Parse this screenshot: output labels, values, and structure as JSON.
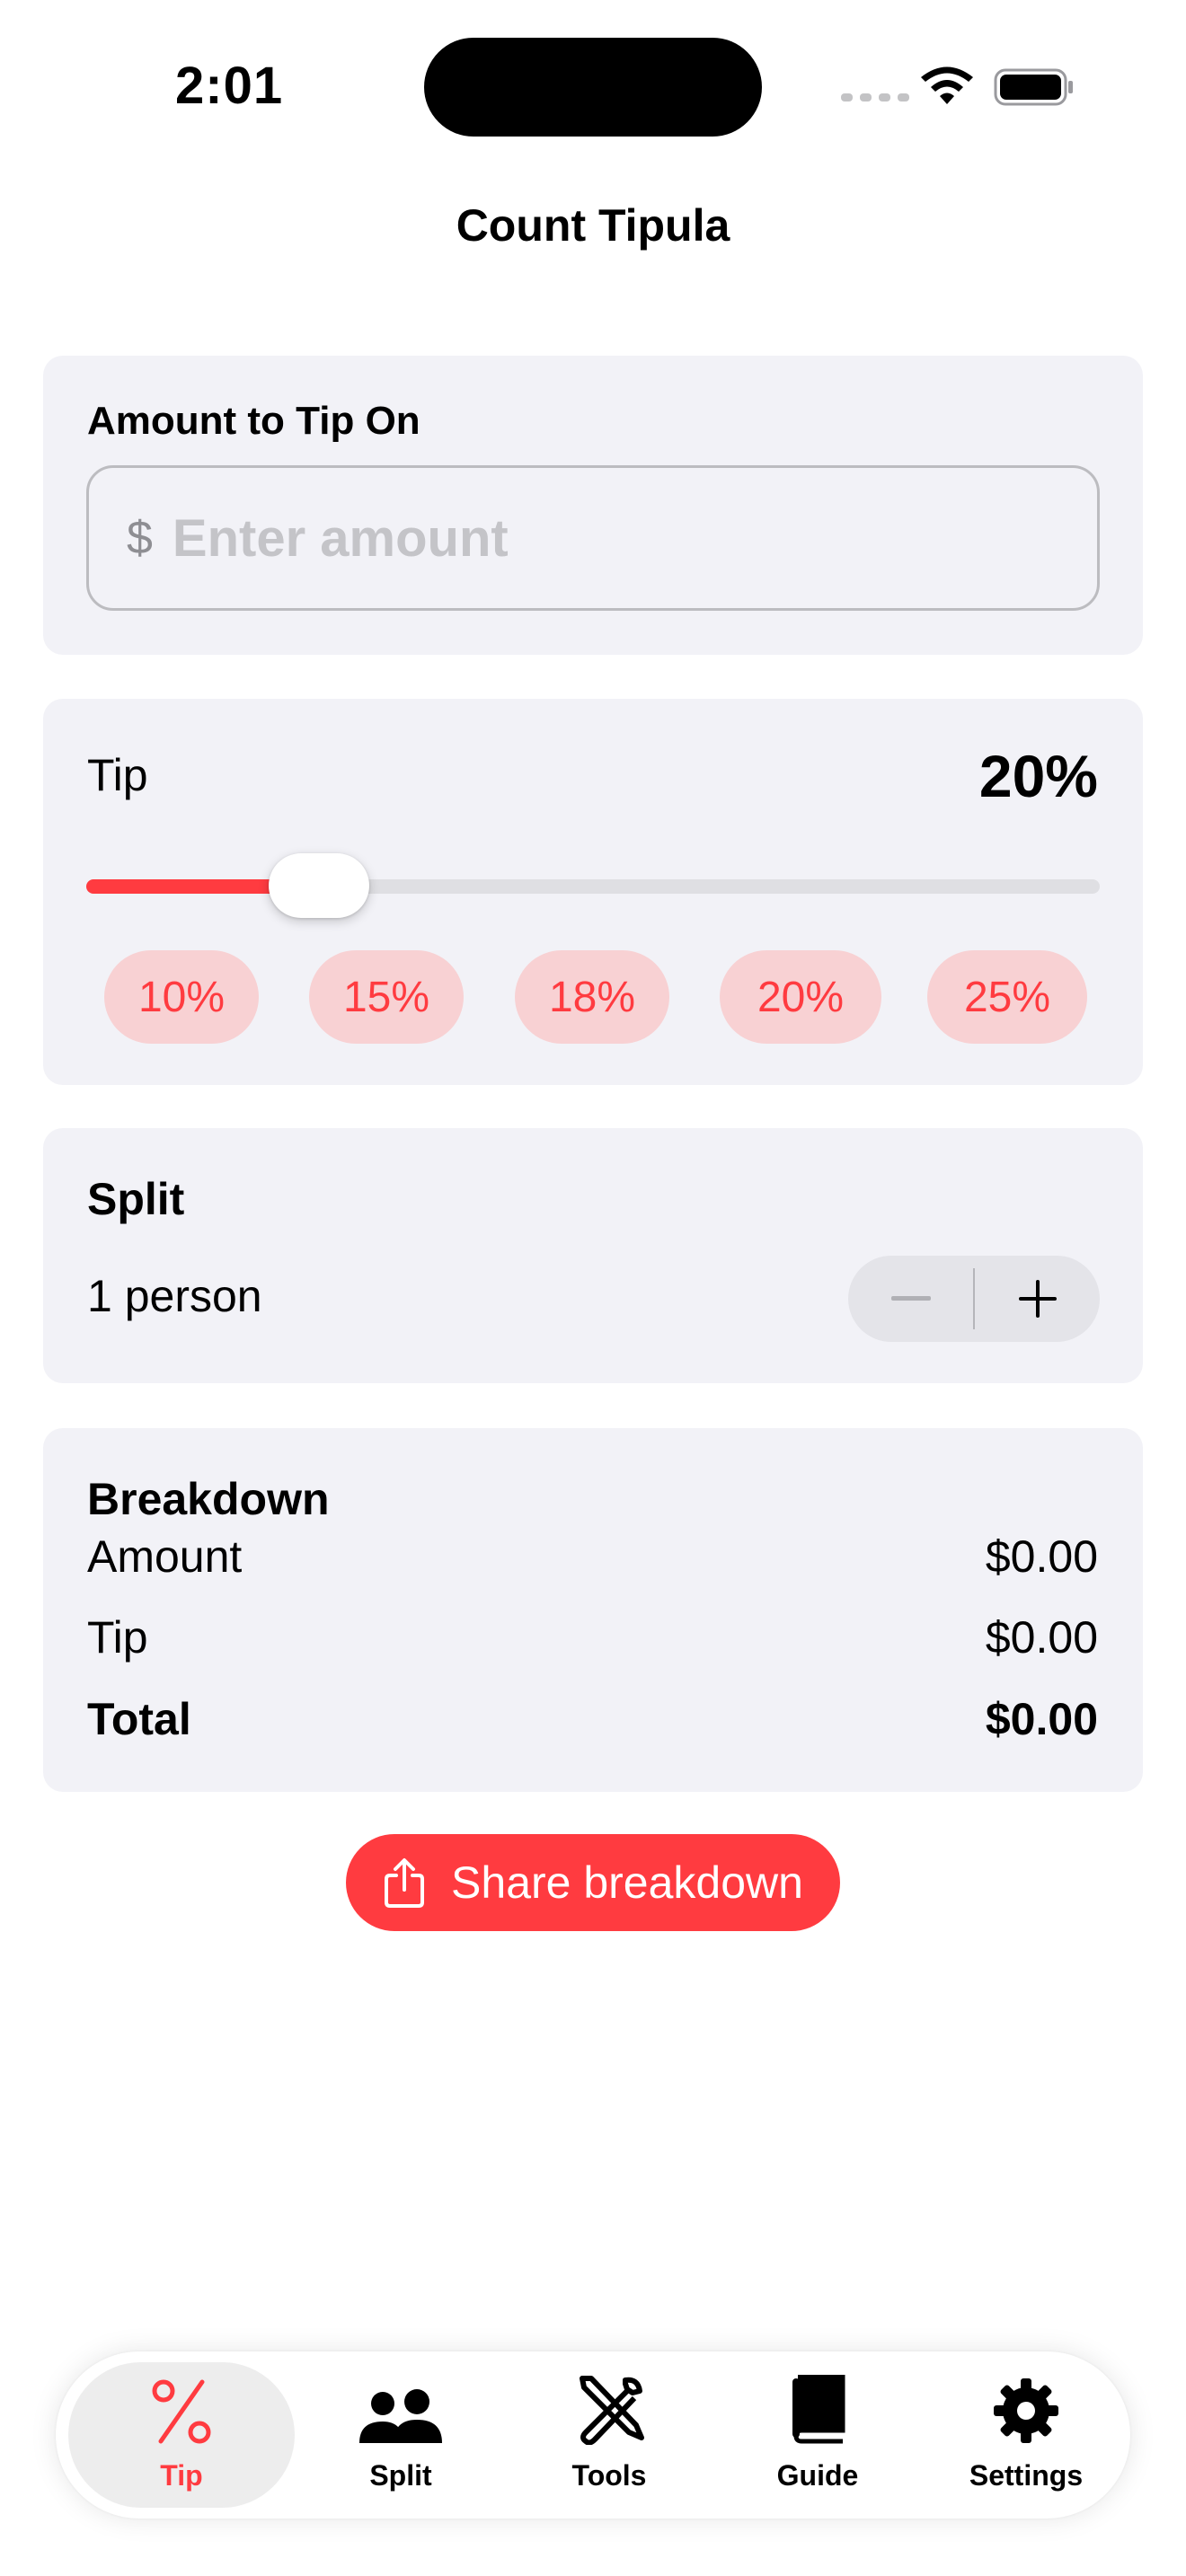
{
  "status_bar": {
    "time": "2:01"
  },
  "nav": {
    "title": "Count Tipula"
  },
  "amount": {
    "label": "Amount to Tip On",
    "currency_symbol": "$",
    "placeholder": "Enter amount",
    "value": ""
  },
  "tip": {
    "label": "Tip",
    "value_display": "20%",
    "slider_fraction": 0.23,
    "presets": [
      "10%",
      "15%",
      "18%",
      "20%",
      "25%"
    ]
  },
  "split": {
    "title": "Split",
    "count_text": "1 person",
    "decrement": "minus",
    "increment": "plus"
  },
  "breakdown": {
    "title": "Breakdown",
    "rows": [
      {
        "label": "Amount",
        "value": "$0.00"
      },
      {
        "label": "Tip",
        "value": "$0.00"
      },
      {
        "label": "Total",
        "value": "$0.00"
      }
    ]
  },
  "share": {
    "label": "Share breakdown",
    "icon": "share-icon"
  },
  "tabbar": {
    "selected": 0,
    "tabs": [
      {
        "label": "Tip",
        "icon": "percent-icon"
      },
      {
        "label": "Split",
        "icon": "people-icon"
      },
      {
        "label": "Tools",
        "icon": "tools-icon"
      },
      {
        "label": "Guide",
        "icon": "book-icon"
      },
      {
        "label": "Settings",
        "icon": "gear-icon"
      }
    ]
  },
  "colors": {
    "accent": "#ff3b40",
    "accent_soft": "#f8d1d3",
    "card": "#f2f2f7",
    "text": "#000000",
    "secondary": "#8e8e93"
  }
}
